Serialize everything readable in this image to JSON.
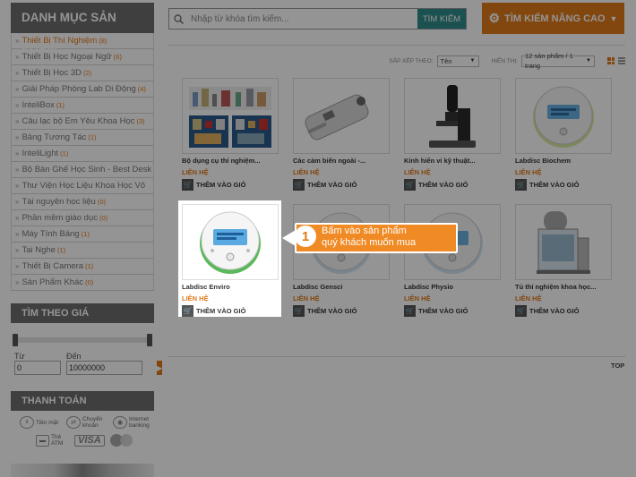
{
  "sidebar": {
    "category_heading": "DANH MỤC SẢN PHẨM",
    "categories": [
      {
        "label": "Thiết Bị Thí Nghiệm",
        "count": "(8)",
        "active": true
      },
      {
        "label": "Thiết Bị Học Ngoại Ngữ",
        "count": "(6)"
      },
      {
        "label": "Thiết Bị Học 3D",
        "count": "(2)"
      },
      {
        "label": "Giải Pháp Phòng Lab Di Động",
        "count": "(4)"
      },
      {
        "label": "InteliBox",
        "count": "(1)"
      },
      {
        "label": "Câu lạc bộ Em Yêu Khoa Học",
        "count": "(3)"
      },
      {
        "label": "Bảng Tương Tác",
        "count": "(1)"
      },
      {
        "label": "InteliLight",
        "count": "(1)"
      },
      {
        "label": "Bộ Bàn Ghế Học Sinh - Best Desk",
        "count": ""
      },
      {
        "label": "Thư Viện Học Liệu Khoa Học Vô",
        "count": ""
      },
      {
        "label": "Tài nguyên học liệu",
        "count": "(0)"
      },
      {
        "label": "Phần mềm giáo dục",
        "count": "(0)"
      },
      {
        "label": "Máy Tính Bảng",
        "count": "(1)"
      },
      {
        "label": "Tai Nghe",
        "count": "(1)"
      },
      {
        "label": "Thiết Bị Camera",
        "count": "(1)"
      },
      {
        "label": "Sản Phẩm Khác",
        "count": "(0)"
      }
    ],
    "price_heading": "TÌM THEO GIÁ",
    "from_label": "Từ",
    "to_label": "Đến",
    "from_value": "0",
    "to_value": "10000000",
    "payment_heading": "THANH TOÁN",
    "payments": [
      "Tiền mặt",
      "Chuyển khoản",
      "Internet banking",
      "Thẻ ATM",
      "VISA"
    ]
  },
  "search": {
    "placeholder": "Nhập từ khóa tìm kiếm...",
    "button": "TÌM KIẾM",
    "advanced": "TÌM KIẾM NÂNG CAO"
  },
  "sort": {
    "sort_label": "SẮP XẾP THEO:",
    "sort_value": "Tên",
    "show_label": "HIỂN THỊ:",
    "show_value": "12 sản phẩm / 1 trang"
  },
  "products": [
    {
      "name": "Bộ dụng cụ thí nghiệm...",
      "price": "LIÊN HỆ",
      "cart": "THÊM VÀO GIỎ",
      "icon": "lab-kit-image"
    },
    {
      "name": "Các cảm biến ngoài -...",
      "price": "LIÊN HỆ",
      "cart": "THÊM VÀO GIỎ",
      "icon": "sensor-image"
    },
    {
      "name": "Kính hiển vi kỹ thuật...",
      "price": "LIÊN HỆ",
      "cart": "THÊM VÀO GIỎ",
      "icon": "microscope-image"
    },
    {
      "name": "Labdisc Biochem",
      "price": "LIÊN HỆ",
      "cart": "THÊM VÀO GIỎ",
      "icon": "labdisc-image"
    },
    {
      "name": "Labdisc Enviro",
      "price": "LIÊN HỆ",
      "cart": "THÊM VÀO GIỎ",
      "icon": "labdisc-image"
    },
    {
      "name": "Labdisc Gensci",
      "price": "LIÊN HỆ",
      "cart": "THÊM VÀO GIỎ",
      "icon": "labdisc-image"
    },
    {
      "name": "Labdisc Physio",
      "price": "LIÊN HỆ",
      "cart": "THÊM VÀO GIỎ",
      "icon": "labdisc-image"
    },
    {
      "name": "Tủ thí nghiệm khoa học...",
      "price": "LIÊN HỆ",
      "cart": "THÊM VÀO GIỎ",
      "icon": "lab-cabinet-image"
    }
  ],
  "top_link": "TOP",
  "tooltip": {
    "step": "1",
    "line1": "Bấm vào sản phẩm",
    "line2": "quý khách muốn mua"
  },
  "colors": {
    "accent": "#e07a1a",
    "search_button": "#2f8c8c",
    "sidebar_heading": "#6d6d6d"
  }
}
